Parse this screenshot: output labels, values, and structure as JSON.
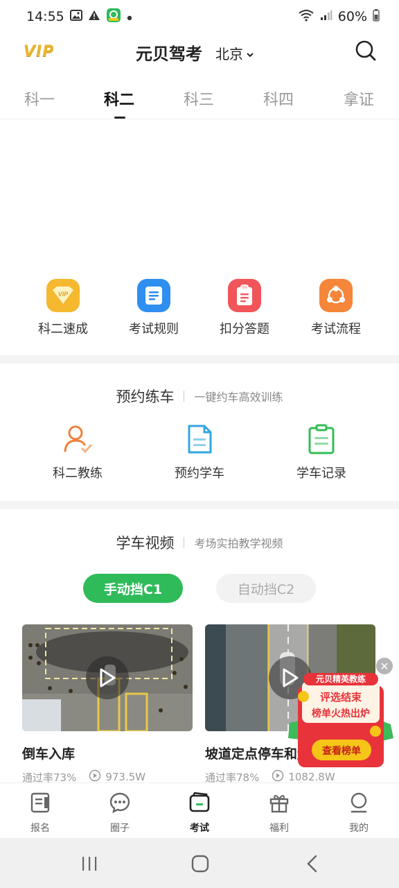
{
  "status_bar": {
    "time": "14:55",
    "battery": "60%"
  },
  "header": {
    "vip_badge": "VIP",
    "app_title": "元贝驾考",
    "city": "北京",
    "search_icon": "search-icon"
  },
  "tabs": [
    {
      "label": "科一",
      "active": false
    },
    {
      "label": "科二",
      "active": true
    },
    {
      "label": "科三",
      "active": false
    },
    {
      "label": "科四",
      "active": false
    },
    {
      "label": "拿证",
      "active": false
    }
  ],
  "quick_grid": [
    {
      "label": "科二速成",
      "icon": "vip-icon",
      "color": "#f5b82e"
    },
    {
      "label": "考试规则",
      "icon": "document-icon",
      "color": "#2e8ff0"
    },
    {
      "label": "扣分答题",
      "icon": "clipboard-icon",
      "color": "#f0555a"
    },
    {
      "label": "考试流程",
      "icon": "share-flow-icon",
      "color": "#f5863a"
    }
  ],
  "booking_section": {
    "title": "预约练车",
    "subtitle": "一键约车高效训练",
    "items": [
      {
        "label": "科二教练",
        "icon": "coach-icon",
        "color": "#f0813a"
      },
      {
        "label": "预约学车",
        "icon": "file-icon",
        "color": "#33a6e0"
      },
      {
        "label": "学车记录",
        "icon": "record-clipboard-icon",
        "color": "#33bb55"
      }
    ]
  },
  "video_section": {
    "title": "学车视频",
    "subtitle": "考场实拍教学视频",
    "segments": [
      {
        "label": "手动挡C1",
        "active": true
      },
      {
        "label": "自动挡C2",
        "active": false
      }
    ],
    "videos": [
      {
        "title": "倒车入库",
        "pass_rate": "通过率73%",
        "plays": "973.5W"
      },
      {
        "title": "坡道定点停车和起步",
        "pass_rate": "通过率78%",
        "plays": "1082.8W"
      }
    ]
  },
  "promo": {
    "tag": "元贝精英教练",
    "line1": "评选结束",
    "line2": "榜单火热出炉",
    "button": "查看榜单"
  },
  "bottom_nav": [
    {
      "label": "报名",
      "icon": "signup-icon",
      "active": false
    },
    {
      "label": "圈子",
      "icon": "chat-icon",
      "active": false
    },
    {
      "label": "考试",
      "icon": "exam-icon",
      "active": true
    },
    {
      "label": "福利",
      "icon": "gift-icon",
      "active": false
    },
    {
      "label": "我的",
      "icon": "profile-icon",
      "active": false
    }
  ],
  "colors": {
    "accent_green": "#2fbb5a",
    "vip_gold": "#e8b632",
    "promo_red": "#e8333a"
  }
}
